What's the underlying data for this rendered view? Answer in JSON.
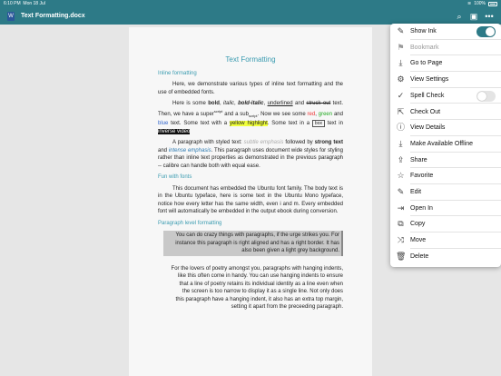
{
  "status": {
    "time": "6:10 PM",
    "date": "Mon 18 Jul",
    "battery": "100%"
  },
  "app": {
    "doc_title": "Text Formatting.docx",
    "doc_icon_letter": "W"
  },
  "document": {
    "title": "Text Formatting",
    "h_inline": "Inline formatting",
    "p1": "Here, we demonstrate various types of inline text formatting and the use of embedded fonts.",
    "p2": {
      "a": "Here is some ",
      "bold": "bold",
      "sep1": ", ",
      "italic": "italic",
      "sep2": ", ",
      "bolditalic": "bold-italic",
      "sep3": ", ",
      "underlined": "underlined",
      "sep4": " and ",
      "struck": "struck out",
      "b": " text. Then, we have a super",
      "sup": "script",
      "c": " and a sub",
      "sub": "script",
      "d": ". Now we see some ",
      "red": "red",
      "sep5": ", ",
      "green": "green",
      "sep6": " and ",
      "blue": "blue",
      "e": " text. Some text with a ",
      "highlight": "yellow highlight",
      "f": ". Some text in a ",
      "box": "box",
      "g": " text in ",
      "inverse": "inverse video"
    },
    "p3": {
      "a": "A paragraph with styled text: ",
      "subtle": "subtle emphasis",
      "b": " followed by ",
      "strong": "strong text",
      "c": " and ",
      "intense": "intense emphasis",
      "d": ". This paragraph uses document wide styles for styling rather than inline text properties as demonstrated in the previous paragraph -- calibre can handle both with equal ease."
    },
    "h_fonts": "Fun with fonts",
    "p4": "This document has embedded the Ubuntu font family. The body text is in the Ubuntu typeface, here is some text in the Ubuntu Mono typeface, notice how every letter has the same width, even i and m. Every embedded font will automatically be embedded in the output ebook during conversion.",
    "h_para": "Paragraph level formatting",
    "p5": "You can do crazy things with paragraphs, if the urge strikes you. For instance this paragraph is right aligned and has a right border. It has also been given a light grey background.",
    "p6": "For the lovers of poetry amongst you, paragraphs with hanging indents, like this often come in handy. You can use hanging indents to ensure that a line of poetry retains its individual identity as a line even when the screen is too narrow to display it as a single line. Not only does this paragraph have a hanging indent, it also has an extra top margin, setting it apart from the preceeding paragraph."
  },
  "menu": {
    "items": [
      {
        "label": "Show Ink",
        "icon": "ink-icon",
        "glyph": "✎",
        "toggle": true,
        "on": true
      },
      {
        "label": "Bookmark",
        "icon": "bookmark-icon",
        "glyph": "⚑",
        "disabled": true
      },
      {
        "label": "Go to Page",
        "icon": "go-to-page-icon",
        "glyph": "⤓"
      },
      {
        "label": "View Settings",
        "icon": "view-settings-icon",
        "glyph": "⚙"
      },
      {
        "label": "Spell Check",
        "icon": "spell-check-icon",
        "glyph": "✓",
        "toggle": true,
        "on": false
      },
      {
        "label": "Check Out",
        "icon": "check-out-icon",
        "glyph": "⇱"
      },
      {
        "label": "View Details",
        "icon": "info-icon",
        "glyph": "ⓘ"
      },
      {
        "label": "Make Available Offline",
        "icon": "download-icon",
        "glyph": "⤓"
      },
      {
        "label": "Share",
        "icon": "share-icon",
        "glyph": "⇪"
      },
      {
        "label": "Favorite",
        "icon": "star-icon",
        "glyph": "☆"
      },
      {
        "label": "Edit",
        "icon": "pencil-icon",
        "glyph": "✎"
      },
      {
        "label": "Open In",
        "icon": "open-in-icon",
        "glyph": "⇥"
      },
      {
        "label": "Copy",
        "icon": "copy-icon",
        "glyph": "⧉"
      },
      {
        "label": "Move",
        "icon": "move-icon",
        "glyph": "⤨"
      },
      {
        "label": "Delete",
        "icon": "trash-icon",
        "glyph": "🗑"
      }
    ]
  },
  "colors": {
    "accent": "#2d7a87",
    "toggle_on": "#2d7a87",
    "toggle_off": "#e4e4e4",
    "heading": "#3a9bb0"
  }
}
